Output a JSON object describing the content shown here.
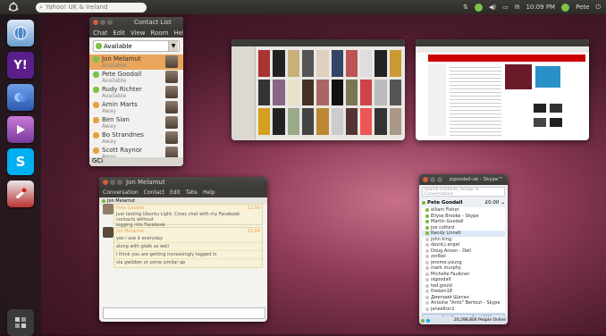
{
  "top_panel": {
    "search_text": "Yahoo! UK & Ireland",
    "clock": "10:09 PM",
    "user": "Pete"
  },
  "launcher": {
    "items": [
      {
        "icon": "chat-globe-icon"
      },
      {
        "icon": "yahoo-messenger-icon",
        "label": "Y!"
      },
      {
        "icon": "blue-app-icon"
      },
      {
        "icon": "media-player-icon"
      },
      {
        "icon": "skype-icon",
        "label": "S"
      },
      {
        "icon": "tools-icon"
      },
      {
        "icon": "workspace-switcher-icon"
      }
    ]
  },
  "contact_list": {
    "title": "Contact List",
    "menu": [
      "Chat",
      "Edit",
      "View",
      "Room",
      "Help"
    ],
    "status": "Available",
    "contacts": [
      {
        "name": "Jon Melamut",
        "status": "Available"
      },
      {
        "name": "Pete Goodall",
        "status": "Available"
      },
      {
        "name": "Rudy Richter",
        "status": "Available"
      },
      {
        "name": "Amin Marts",
        "status": "Away"
      },
      {
        "name": "Ben Sian",
        "status": "Away"
      },
      {
        "name": "Bo Strandnes",
        "status": "Away"
      },
      {
        "name": "Scott Raynor",
        "status": "Away"
      }
    ],
    "footer": "GCi"
  },
  "chat_window": {
    "title": "Jon Melamut",
    "menu": [
      "Conversation",
      "Contact",
      "Edit",
      "Tabs",
      "Help"
    ],
    "tab": "Jon Melamut",
    "messages": [
      {
        "author": "Pete Goodall",
        "time": "22:09",
        "lines": [
          "Just testing Ubuntu Light. Cross chat with my Facebook contacts without",
          "logging into Facebook"
        ]
      },
      {
        "author": "Jon Melamut",
        "time": "22:09",
        "lines": [
          "yes i use it everyday",
          "along with gtalk as well",
          "i think you are getting increasingly tagged in",
          "via gwibber or some similar ap"
        ]
      }
    ]
  },
  "skype_window": {
    "title": "pgoodall-uk - Skype™",
    "search": "Search Contacts, Groups & Conversations",
    "user": "Pete Goodall",
    "credit": "£0.00",
    "contacts": [
      "elliam Fisher",
      "Ellyse Brooke - Skype",
      "Martin Goodall",
      "joe colford",
      "Randy Linnell",
      "john king",
      "david.j.angel",
      "Doug Anson - Dell",
      "zorlbel",
      "jerome.young",
      "mark murphy",
      "Michelle Faulkner",
      "slgoodall",
      "ted.gould",
      "theben18",
      "Дмитрий Шатан",
      "Antoine \"Anto\" Bertout - Skype",
      "janeelton1"
    ],
    "call_button": "Call Phones or Send SMS",
    "online_count": "20,298,804 People Online"
  },
  "colors": {
    "panel": "#3c3b37",
    "accent_orange": "#e9a55b",
    "wallpaper": "#8d3a56",
    "skype_blue": "#00aff0"
  }
}
